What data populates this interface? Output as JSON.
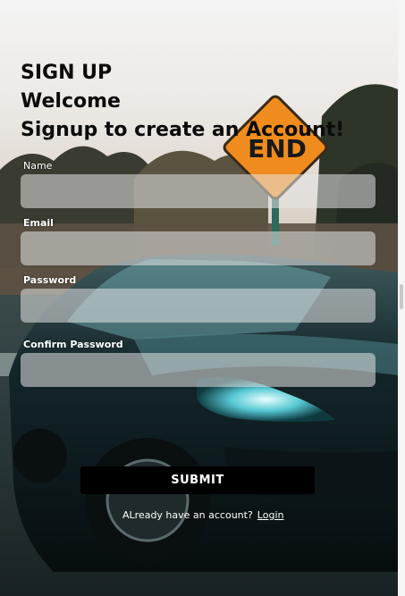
{
  "form": {
    "heading": "SIGN UP",
    "welcome": "Welcome",
    "subheading": "Signup to create an Account!",
    "fields": [
      {
        "label": "Name",
        "value": "",
        "placeholder": ""
      },
      {
        "label": "Email",
        "value": "",
        "placeholder": ""
      },
      {
        "label": "Password",
        "value": "",
        "placeholder": ""
      },
      {
        "label": "Confirm Password",
        "value": "",
        "placeholder": ""
      }
    ],
    "submit_label": "SUBMIT",
    "footer_text": "ALready have an account?",
    "login_link": "Login"
  },
  "background": {
    "sign_text": "END",
    "sign_color": "#f08c1e"
  },
  "colors": {
    "button_bg": "#000000",
    "input_bg": "rgba(230,230,230,0.55)",
    "title_text": "#0b0b0b"
  }
}
